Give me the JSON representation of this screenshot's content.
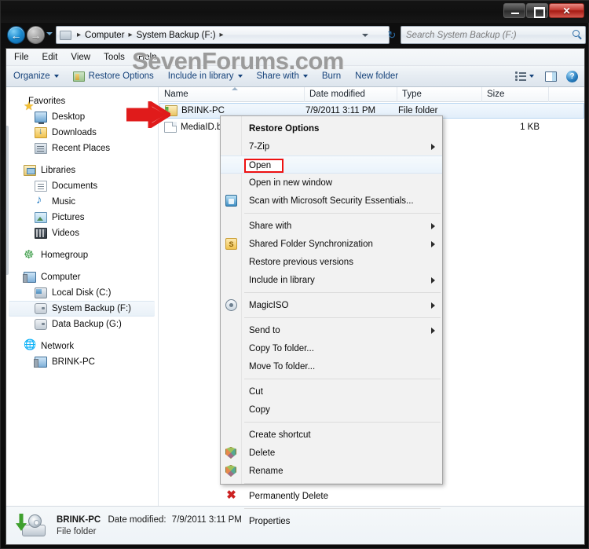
{
  "window": {
    "watermark": "SevenForums.com",
    "controls": {
      "minimize": "Minimize",
      "maximize": "Maximize",
      "close": "Close"
    }
  },
  "address_bar": {
    "back_glyph": "←",
    "forward_glyph": "→",
    "crumbs": [
      "Computer",
      "System Backup (F:)"
    ],
    "separator": "▸",
    "refresh_glyph": "↻"
  },
  "search": {
    "placeholder": "Search System Backup (F:)",
    "value": ""
  },
  "menubar": {
    "items": [
      "File",
      "Edit",
      "View",
      "Tools",
      "Help"
    ]
  },
  "toolbar": {
    "organize": "Organize",
    "restore_options": "Restore Options",
    "include_in_library": "Include in library",
    "share_with": "Share with",
    "burn": "Burn",
    "new_folder": "New folder",
    "help_glyph": "?"
  },
  "navigation_pane": {
    "groups": [
      {
        "header": {
          "label": "Favorites",
          "icon": "star-icon"
        },
        "items": [
          {
            "label": "Desktop",
            "icon": "desktop-icon"
          },
          {
            "label": "Downloads",
            "icon": "downloads-icon"
          },
          {
            "label": "Recent Places",
            "icon": "recent-places-icon"
          }
        ]
      },
      {
        "header": {
          "label": "Libraries",
          "icon": "libraries-icon"
        },
        "items": [
          {
            "label": "Documents",
            "icon": "document-icon"
          },
          {
            "label": "Music",
            "icon": "music-note-icon"
          },
          {
            "label": "Pictures",
            "icon": "picture-icon"
          },
          {
            "label": "Videos",
            "icon": "video-icon"
          }
        ]
      },
      {
        "header": {
          "label": "Homegroup",
          "icon": "homegroup-icon"
        },
        "items": []
      },
      {
        "header": {
          "label": "Computer",
          "icon": "computer-icon"
        },
        "items": [
          {
            "label": "Local Disk (C:)",
            "icon": "hard-disk-icon",
            "selected": false
          },
          {
            "label": "System Backup (F:)",
            "icon": "drive-icon",
            "selected": true
          },
          {
            "label": "Data Backup (G:)",
            "icon": "drive-icon",
            "selected": false
          }
        ]
      },
      {
        "header": {
          "label": "Network",
          "icon": "network-icon"
        },
        "items": [
          {
            "label": "BRINK-PC",
            "icon": "computer-icon"
          }
        ]
      }
    ]
  },
  "file_list": {
    "columns": [
      "Name",
      "Date modified",
      "Type",
      "Size"
    ],
    "sorted_column": "Name",
    "rows": [
      {
        "name": "BRINK-PC",
        "date_modified": "7/9/2011 3:11 PM",
        "type": "File folder",
        "size": "",
        "icon": "backup-folder-icon",
        "selected": true
      },
      {
        "name": "MediaID.bin",
        "date_modified": "",
        "type": "",
        "size": "1 KB",
        "icon": "bin-file-icon",
        "selected": false
      }
    ]
  },
  "context_menu": {
    "items": [
      {
        "label": "Restore Options",
        "bold": true,
        "submenu": false,
        "icon": null,
        "highlighted": false
      },
      {
        "label": "7-Zip",
        "bold": false,
        "submenu": true,
        "icon": null,
        "highlighted": false
      },
      {
        "label": "Open",
        "bold": false,
        "submenu": false,
        "icon": null,
        "highlighted": true
      },
      {
        "label": "Open in new window",
        "bold": false,
        "submenu": false,
        "icon": null,
        "highlighted": false
      },
      {
        "label": "Scan with Microsoft Security Essentials...",
        "bold": false,
        "submenu": false,
        "icon": "security-essentials-icon",
        "highlighted": false
      },
      {
        "separator": true
      },
      {
        "label": "Share with",
        "bold": false,
        "submenu": true,
        "icon": null,
        "highlighted": false
      },
      {
        "label": "Shared Folder Synchronization",
        "bold": false,
        "submenu": true,
        "icon": "sync-icon",
        "highlighted": false
      },
      {
        "label": "Restore previous versions",
        "bold": false,
        "submenu": false,
        "icon": null,
        "highlighted": false
      },
      {
        "label": "Include in library",
        "bold": false,
        "submenu": true,
        "icon": null,
        "highlighted": false
      },
      {
        "separator": true
      },
      {
        "label": "MagicISO",
        "bold": false,
        "submenu": true,
        "icon": "magiciso-icon",
        "highlighted": false
      },
      {
        "separator": true
      },
      {
        "label": "Send to",
        "bold": false,
        "submenu": true,
        "icon": null,
        "highlighted": false
      },
      {
        "label": "Copy To folder...",
        "bold": false,
        "submenu": false,
        "icon": null,
        "highlighted": false
      },
      {
        "label": "Move To folder...",
        "bold": false,
        "submenu": false,
        "icon": null,
        "highlighted": false
      },
      {
        "separator": true
      },
      {
        "label": "Cut",
        "bold": false,
        "submenu": false,
        "icon": null,
        "highlighted": false
      },
      {
        "label": "Copy",
        "bold": false,
        "submenu": false,
        "icon": null,
        "highlighted": false
      },
      {
        "separator": true
      },
      {
        "label": "Create shortcut",
        "bold": false,
        "submenu": false,
        "icon": null,
        "highlighted": false
      },
      {
        "label": "Delete",
        "bold": false,
        "submenu": false,
        "icon": "uac-shield-icon",
        "highlighted": false
      },
      {
        "label": "Rename",
        "bold": false,
        "submenu": false,
        "icon": "uac-shield-icon",
        "highlighted": false
      },
      {
        "separator": true
      },
      {
        "label": "Permanently Delete",
        "bold": false,
        "submenu": false,
        "icon": "red-x-icon",
        "highlighted": false
      },
      {
        "separator": true
      },
      {
        "label": "Properties",
        "bold": false,
        "submenu": false,
        "icon": null,
        "highlighted": false
      }
    ],
    "highlight_box_label": "Open"
  },
  "details_pane": {
    "name": "BRINK-PC",
    "date_label": "Date modified:",
    "date_value": "7/9/2011 3:11 PM",
    "type": "File folder"
  },
  "annotations": {
    "arrow_color": "#e01b1b",
    "highlight_color": "#ee1111"
  }
}
